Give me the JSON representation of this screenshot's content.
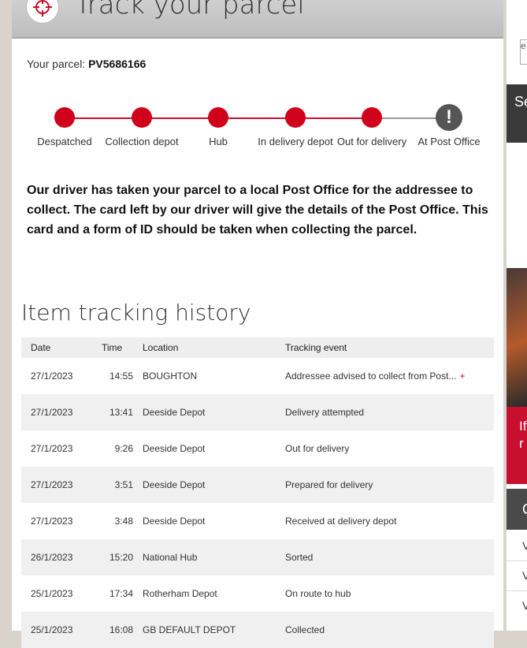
{
  "header": {
    "title": "Track your parcel"
  },
  "parcel": {
    "label": "Your parcel:",
    "number": "PV5686166"
  },
  "steps": [
    {
      "label": "Despatched"
    },
    {
      "label": "Collection depot"
    },
    {
      "label": "Hub"
    },
    {
      "label": "In delivery depot"
    },
    {
      "label": "Out for delivery"
    },
    {
      "label": "At Post Office",
      "current": true,
      "glyph": "!"
    }
  ],
  "message": "Our driver has taken your parcel to a local Post Office for the addressee to collect. The card left by our driver will give the details of the Post Office. This card and a form of ID should be taken when collecting the parcel.",
  "history": {
    "title": "Item tracking history",
    "columns": [
      "Date",
      "Time",
      "Location",
      "Tracking event"
    ],
    "rows": [
      [
        "27/1/2023",
        "14:55",
        "BOUGHTON",
        "Addressee advised to collect from Post..."
      ],
      [
        "27/1/2023",
        "13:41",
        "Deeside Depot",
        "Delivery attempted"
      ],
      [
        "27/1/2023",
        "9:26",
        "Deeside Depot",
        "Out for delivery"
      ],
      [
        "27/1/2023",
        "3:51",
        "Deeside Depot",
        "Prepared for delivery"
      ],
      [
        "27/1/2023",
        "3:48",
        "Deeside Depot",
        "Received at delivery depot"
      ],
      [
        "26/1/2023",
        "15:20",
        "National Hub",
        "Sorted"
      ],
      [
        "25/1/2023",
        "17:34",
        "Rotherham Depot",
        "On route to hub"
      ],
      [
        "25/1/2023",
        "16:08",
        "GB DEFAULT DEPOT",
        "Collected"
      ]
    ],
    "expand_glyph": "+"
  },
  "sidebar": {
    "input_text": "e",
    "dark_bar_text": "Se",
    "red_text": "If r",
    "grey_text": "C",
    "link_texts": [
      "V",
      "V",
      "V"
    ]
  },
  "colors": {
    "accent": "#c8102e",
    "dot": "#d0021b",
    "current": "#555555"
  }
}
